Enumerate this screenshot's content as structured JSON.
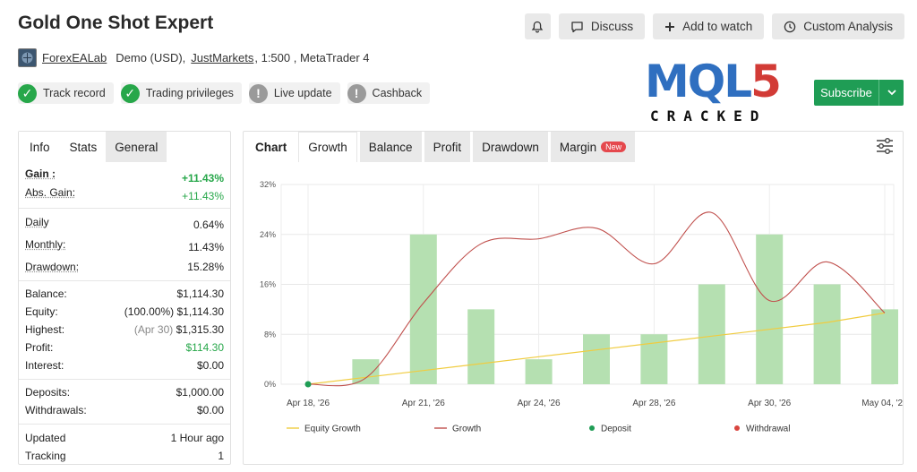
{
  "title": "Gold One Shot Expert",
  "top_buttons": {
    "discuss": "Discuss",
    "watch": "Add to watch",
    "custom": "Custom Analysis"
  },
  "account": {
    "author": "ForexEALab",
    "type": "Demo (USD),",
    "broker": "JustMarkets",
    "details": ", 1:500 , MetaTrader 4"
  },
  "badges": {
    "track": "Track record",
    "trading": "Trading privileges",
    "live": "Live update",
    "cashback": "Cashback"
  },
  "logo": {
    "part1": "MQL",
    "part2": "5",
    "sub": "CRACKED"
  },
  "subscribe": "Subscribe",
  "left_tabs": {
    "info": "Info",
    "stats": "Stats",
    "general": "General"
  },
  "stats": {
    "gain_k": "Gain :",
    "gain_v": "+11.43%",
    "abs_k": "Abs. Gain:",
    "abs_v": "+11.43%",
    "daily_k": "Daily",
    "daily_v": "0.64%",
    "monthly_k": "Monthly:",
    "monthly_v": "11.43%",
    "dd_k": "Drawdown:",
    "dd_v": "15.28%",
    "balance_k": "Balance:",
    "balance_v": "$1,114.30",
    "equity_k": "Equity:",
    "equity_pct": "(100.00%)",
    "equity_v": "$1,114.30",
    "highest_k": "Highest:",
    "highest_date": "(Apr 30)",
    "highest_v": "$1,315.30",
    "profit_k": "Profit:",
    "profit_v": "$114.30",
    "interest_k": "Interest:",
    "interest_v": "$0.00",
    "deposits_k": "Deposits:",
    "deposits_v": "$1,000.00",
    "withdrawals_k": "Withdrawals:",
    "withdrawals_v": "$0.00",
    "updated_k": "Updated",
    "updated_v": "1 Hour ago",
    "tracking_k": "Tracking",
    "tracking_v": "1"
  },
  "right_tabs": {
    "chart": "Chart",
    "growth": "Growth",
    "balance": "Balance",
    "profit": "Profit",
    "drawdown": "Drawdown",
    "margin": "Margin",
    "new": "New"
  },
  "colors": {
    "bar": "#b5e0b1",
    "growth_line": "#c0504d",
    "equity_line": "#f0cc40",
    "deposit": "#1f9d55",
    "withdrawal": "#d9453f"
  },
  "chart_data": {
    "type": "bar",
    "ylim": [
      0,
      32
    ],
    "yticks": [
      "0%",
      "8%",
      "16%",
      "24%",
      "32%"
    ],
    "xticks": [
      "Apr 18, '26",
      "Apr 21, '26",
      "Apr 24, '26",
      "Apr 28, '26",
      "Apr 30, '26",
      "May 04, '26"
    ],
    "x": [
      0,
      1,
      2,
      3,
      4,
      5,
      6,
      7,
      8,
      9,
      10
    ],
    "bars": [
      0,
      4,
      24,
      12,
      4,
      8,
      8,
      16,
      24,
      16,
      12
    ],
    "series": [
      {
        "name": "Equity Growth",
        "values": [
          0,
          1.1,
          2.2,
          3.3,
          4.4,
          5.5,
          6.6,
          7.7,
          8.8,
          9.9,
          11.43
        ]
      },
      {
        "name": "Growth",
        "values": [
          0,
          1,
          13,
          22.5,
          23.3,
          25,
          19.3,
          27.5,
          13.4,
          19.6,
          11.43
        ]
      }
    ],
    "legend": [
      "Equity Growth",
      "Growth",
      "Deposit",
      "Withdrawal"
    ]
  }
}
